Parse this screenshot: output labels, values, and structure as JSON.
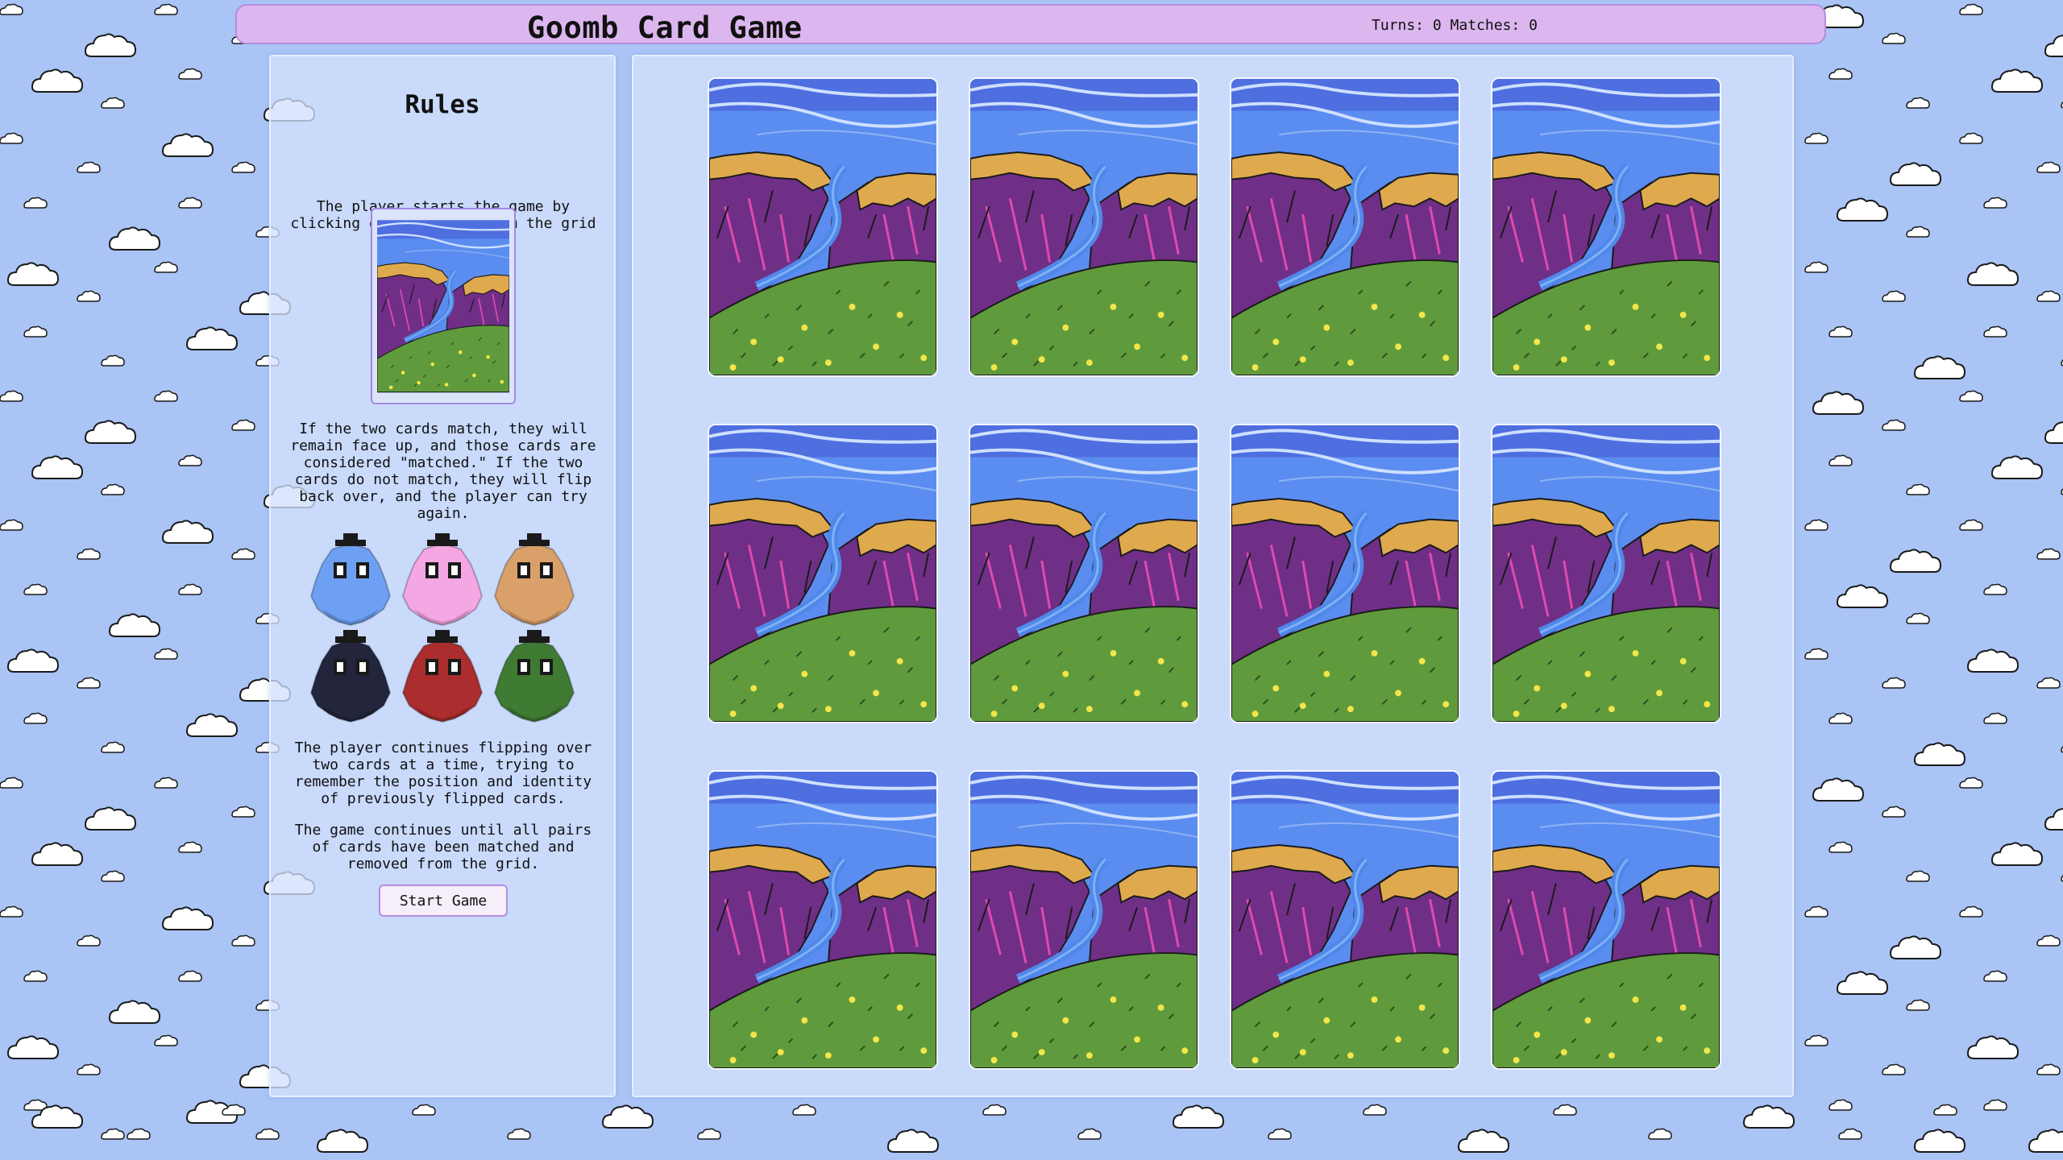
{
  "header": {
    "title": "Goomb Card Game",
    "stats_label": "Turns: 0 Matches: 0"
  },
  "rules": {
    "title": "Rules",
    "p1": "The player starts the game by clicking on two cards from the grid to reveal them.",
    "p2": "If the two cards match, they will remain face up, and those cards are considered \"matched.\" If the two cards do not match, they will flip back over, and the player can try again.",
    "p3": "The player continues flipping over two cards at a time, trying to remember the position and identity of previously flipped cards.",
    "p4": "The game continues until all pairs of cards have been matched and removed from the grid.",
    "start_button": "Start Game",
    "goombs": [
      {
        "name": "blue",
        "color": "#6da0f2"
      },
      {
        "name": "pink",
        "color": "#f5a7e3"
      },
      {
        "name": "tan",
        "color": "#d9a06a"
      },
      {
        "name": "black",
        "color": "#23253d"
      },
      {
        "name": "red",
        "color": "#ab2d2d"
      },
      {
        "name": "green",
        "color": "#3f7b33"
      }
    ]
  },
  "board": {
    "rows": 3,
    "cols": 4,
    "cards": [
      {
        "state": "face-down"
      },
      {
        "state": "face-down"
      },
      {
        "state": "face-down"
      },
      {
        "state": "face-down"
      },
      {
        "state": "face-down"
      },
      {
        "state": "face-down"
      },
      {
        "state": "face-down"
      },
      {
        "state": "face-down"
      },
      {
        "state": "face-down"
      },
      {
        "state": "face-down"
      },
      {
        "state": "face-down"
      },
      {
        "state": "face-down"
      }
    ]
  },
  "colors": {
    "background": "#a9c4f5",
    "header_bg": "#dcb6ee",
    "panel_bg": "#d2e0fc",
    "card_sky": "#5a8bef",
    "card_mountain": "#6f2f86",
    "card_cliff": "#dfaa4e",
    "card_grass": "#5f9b3c"
  }
}
